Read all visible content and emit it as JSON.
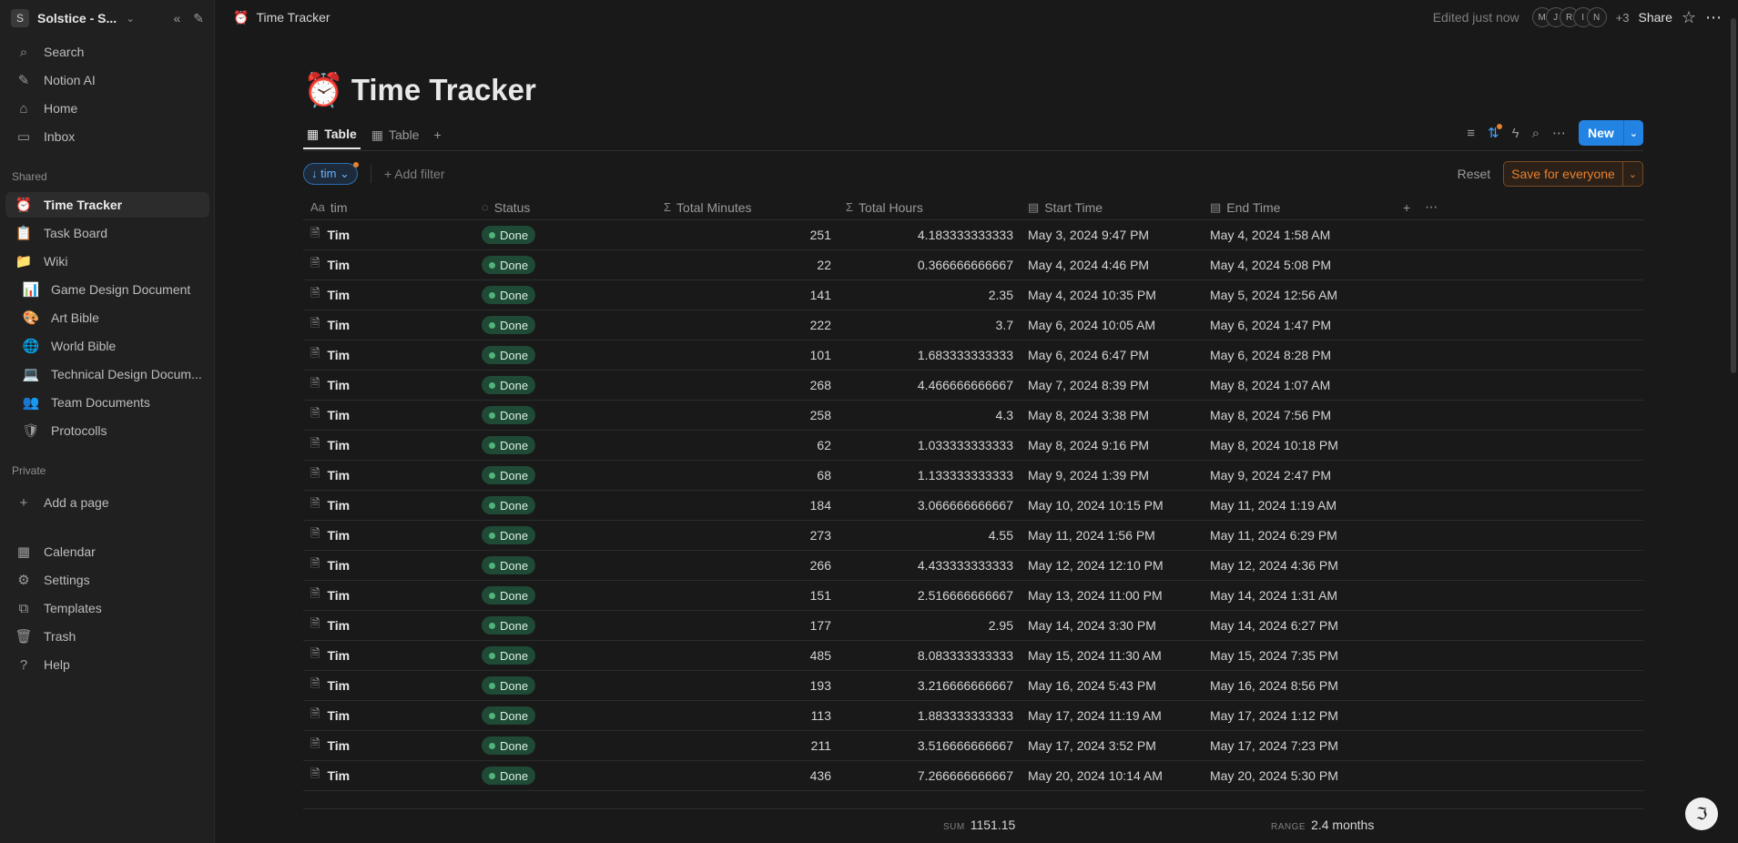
{
  "workspace": {
    "name": "Solstice - S...",
    "initial": "S"
  },
  "sidebar": {
    "top": [
      {
        "label": "Search",
        "icon": "search-icon",
        "glyph": "⌕"
      },
      {
        "label": "Notion AI",
        "icon": "sparkle-icon",
        "glyph": "✎"
      },
      {
        "label": "Home",
        "icon": "home-icon",
        "glyph": "⌂"
      },
      {
        "label": "Inbox",
        "icon": "inbox-icon",
        "glyph": "▭"
      }
    ],
    "shared_label": "Shared",
    "shared": [
      {
        "label": "Time Tracker",
        "icon": "alarm-clock-icon",
        "glyph": "⏰"
      },
      {
        "label": "Task Board",
        "icon": "clipboard-icon",
        "glyph": "📋"
      },
      {
        "label": "Wiki",
        "icon": "folder-icon",
        "glyph": "📁"
      },
      {
        "label": "Game Design Document",
        "icon": "chart-icon",
        "glyph": "📊"
      },
      {
        "label": "Art Bible",
        "icon": "palette-icon",
        "glyph": "🎨"
      },
      {
        "label": "World Bible",
        "icon": "globe-icon",
        "glyph": "🌐"
      },
      {
        "label": "Technical Design Docum...",
        "icon": "computer-icon",
        "glyph": "💻"
      },
      {
        "label": "Team Documents",
        "icon": "people-icon",
        "glyph": "👥"
      },
      {
        "label": "Protocolls",
        "icon": "shield-icon",
        "glyph": "🛡"
      }
    ],
    "private_label": "Private",
    "add_page": "Add a page",
    "bottom": [
      {
        "label": "Calendar",
        "icon": "calendar-icon",
        "glyph": "▦"
      },
      {
        "label": "Settings",
        "icon": "gear-icon",
        "glyph": "⚙"
      },
      {
        "label": "Templates",
        "icon": "templates-icon",
        "glyph": "⧉"
      },
      {
        "label": "Trash",
        "icon": "trash-icon",
        "glyph": "🗑"
      },
      {
        "label": "Help",
        "icon": "help-icon",
        "glyph": "?"
      }
    ]
  },
  "topbar": {
    "breadcrumb": "Time Tracker",
    "edited": "Edited just now",
    "avatars": [
      "M",
      "J",
      "R",
      "I",
      "N"
    ],
    "more_count": "+3",
    "share": "Share"
  },
  "page": {
    "emoji": "⏰",
    "title": "Time Tracker",
    "views": [
      "Table",
      "Table"
    ],
    "new_label": "New",
    "filter_chip": "↓ tim ⌄",
    "add_filter": "Add filter",
    "reset": "Reset",
    "save": "Save for everyone"
  },
  "table": {
    "columns": [
      {
        "label": "tim",
        "icon": "Aa"
      },
      {
        "label": "Status",
        "icon": "◌"
      },
      {
        "label": "Total Minutes",
        "icon": "Σ"
      },
      {
        "label": "Total Hours",
        "icon": "Σ"
      },
      {
        "label": "Start Time",
        "icon": "▤"
      },
      {
        "label": "End Time",
        "icon": "▤"
      }
    ],
    "rows": [
      {
        "name": "Tim",
        "status": "Done",
        "minutes": "251",
        "hours": "4.183333333333",
        "start": "May 3, 2024 9:47 PM",
        "end": "May 4, 2024 1:58 AM"
      },
      {
        "name": "Tim",
        "status": "Done",
        "minutes": "22",
        "hours": "0.366666666667",
        "start": "May 4, 2024 4:46 PM",
        "end": "May 4, 2024 5:08 PM"
      },
      {
        "name": "Tim",
        "status": "Done",
        "minutes": "141",
        "hours": "2.35",
        "start": "May 4, 2024 10:35 PM",
        "end": "May 5, 2024 12:56 AM"
      },
      {
        "name": "Tim",
        "status": "Done",
        "minutes": "222",
        "hours": "3.7",
        "start": "May 6, 2024 10:05 AM",
        "end": "May 6, 2024 1:47 PM"
      },
      {
        "name": "Tim",
        "status": "Done",
        "minutes": "101",
        "hours": "1.683333333333",
        "start": "May 6, 2024 6:47 PM",
        "end": "May 6, 2024 8:28 PM"
      },
      {
        "name": "Tim",
        "status": "Done",
        "minutes": "268",
        "hours": "4.466666666667",
        "start": "May 7, 2024 8:39 PM",
        "end": "May 8, 2024 1:07 AM"
      },
      {
        "name": "Tim",
        "status": "Done",
        "minutes": "258",
        "hours": "4.3",
        "start": "May 8, 2024 3:38 PM",
        "end": "May 8, 2024 7:56 PM"
      },
      {
        "name": "Tim",
        "status": "Done",
        "minutes": "62",
        "hours": "1.033333333333",
        "start": "May 8, 2024 9:16 PM",
        "end": "May 8, 2024 10:18 PM"
      },
      {
        "name": "Tim",
        "status": "Done",
        "minutes": "68",
        "hours": "1.133333333333",
        "start": "May 9, 2024 1:39 PM",
        "end": "May 9, 2024 2:47 PM"
      },
      {
        "name": "Tim",
        "status": "Done",
        "minutes": "184",
        "hours": "3.066666666667",
        "start": "May 10, 2024 10:15 PM",
        "end": "May 11, 2024 1:19 AM"
      },
      {
        "name": "Tim",
        "status": "Done",
        "minutes": "273",
        "hours": "4.55",
        "start": "May 11, 2024 1:56 PM",
        "end": "May 11, 2024 6:29 PM"
      },
      {
        "name": "Tim",
        "status": "Done",
        "minutes": "266",
        "hours": "4.433333333333",
        "start": "May 12, 2024 12:10 PM",
        "end": "May 12, 2024 4:36 PM"
      },
      {
        "name": "Tim",
        "status": "Done",
        "minutes": "151",
        "hours": "2.516666666667",
        "start": "May 13, 2024 11:00 PM",
        "end": "May 14, 2024 1:31 AM"
      },
      {
        "name": "Tim",
        "status": "Done",
        "minutes": "177",
        "hours": "2.95",
        "start": "May 14, 2024 3:30 PM",
        "end": "May 14, 2024 6:27 PM"
      },
      {
        "name": "Tim",
        "status": "Done",
        "minutes": "485",
        "hours": "8.083333333333",
        "start": "May 15, 2024 11:30 AM",
        "end": "May 15, 2024 7:35 PM"
      },
      {
        "name": "Tim",
        "status": "Done",
        "minutes": "193",
        "hours": "3.216666666667",
        "start": "May 16, 2024 5:43 PM",
        "end": "May 16, 2024 8:56 PM"
      },
      {
        "name": "Tim",
        "status": "Done",
        "minutes": "113",
        "hours": "1.883333333333",
        "start": "May 17, 2024 11:19 AM",
        "end": "May 17, 2024 1:12 PM"
      },
      {
        "name": "Tim",
        "status": "Done",
        "minutes": "211",
        "hours": "3.516666666667",
        "start": "May 17, 2024 3:52 PM",
        "end": "May 17, 2024 7:23 PM"
      },
      {
        "name": "Tim",
        "status": "Done",
        "minutes": "436",
        "hours": "7.266666666667",
        "start": "May 20, 2024 10:14 AM",
        "end": "May 20, 2024 5:30 PM"
      }
    ]
  },
  "footer": {
    "sum_label": "SUM",
    "sum_value": "1151.15",
    "range_label": "RANGE",
    "range_value": "2.4 months"
  },
  "colors": {
    "background": "#191919",
    "sidebar": "#202020",
    "accent_blue": "#2383e2",
    "accent_orange": "#e8812f",
    "done_green": "#1f4a35"
  }
}
